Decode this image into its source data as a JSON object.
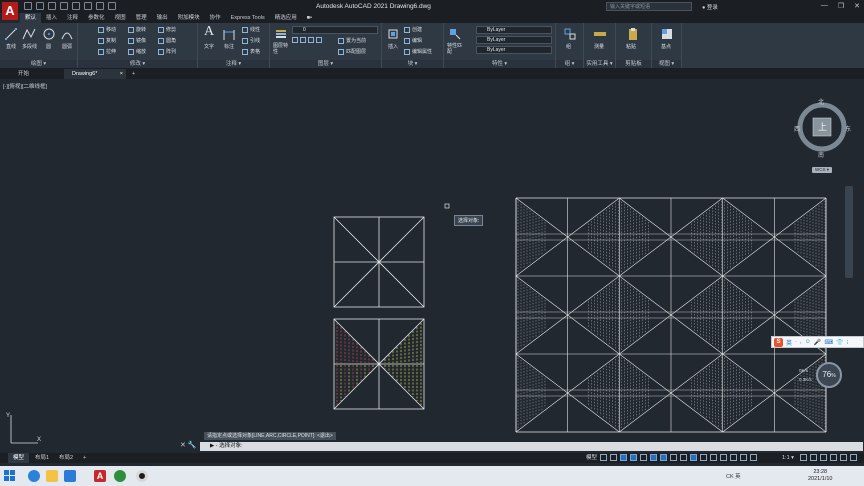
{
  "app": {
    "logo_letter": "A",
    "title": "Autodesk AutoCAD 2021    Drawing6.dwg",
    "search_placeholder": "输入关键字或短语",
    "user_label": "登录",
    "window_controls": [
      "—",
      "❐",
      "✕"
    ]
  },
  "menu": {
    "tabs": [
      "默认",
      "插入",
      "注释",
      "参数化",
      "视图",
      "管理",
      "输出",
      "附加模块",
      "协作",
      "Express Tools",
      "精选应用",
      "■▪"
    ],
    "active_index": 0
  },
  "ribbon": {
    "panels": {
      "draw": {
        "label": "绘图 ▾",
        "line": "直线",
        "polyline": "多段线",
        "circle": "圆",
        "arc": "圆弧"
      },
      "modify": {
        "label": "修改 ▾",
        "move": "移动",
        "rotate": "旋转",
        "trim": "修剪",
        "copy": "复制",
        "mirror": "镜像",
        "fillet": "圆角",
        "stretch": "拉伸",
        "scale": "缩放",
        "array": "阵列"
      },
      "annotation": {
        "label": "注释 ▾",
        "text": "文字",
        "dimension": "标注",
        "linear": "线性",
        "leader": "引线",
        "table": "表格"
      },
      "layers": {
        "label": "图层 ▾",
        "layer_properties": "图层特性",
        "layer_value": "0",
        "make_current": "置为当前",
        "match_layer": "匹配图层"
      },
      "block": {
        "label": "块 ▾",
        "insert": "插入",
        "create": "创建",
        "edit": "编辑",
        "edit_attributes": "编辑属性"
      },
      "properties": {
        "label": "特性 ▾",
        "match": "特性匹配",
        "color": "ByLayer",
        "linetype": "ByLayer",
        "lineweight": "ByLayer"
      },
      "groups": {
        "label": "组 ▾",
        "group": "组"
      },
      "utilities": {
        "label": "实用工具 ▾",
        "measure": "测量"
      },
      "clipboard": {
        "label": "剪贴板",
        "paste": "粘贴"
      },
      "view": {
        "label": "视图 ▾",
        "base": "基点"
      }
    }
  },
  "doc_tabs": {
    "start": "开始",
    "drawing": "Drawing6*",
    "close": "×",
    "add": "+"
  },
  "viewport": {
    "label": "[-][俯视][二维线框]",
    "tooltip": "选择对象:"
  },
  "viewcube": {
    "top": "上",
    "north": "北",
    "south": "南",
    "east": "东",
    "west": "西",
    "wcs": "WCS ▾"
  },
  "ime": {
    "logo": "S",
    "lang": "英",
    "icons": [
      "·",
      ",",
      "☺",
      "🎤",
      "⌨",
      "👕",
      "⁝"
    ]
  },
  "performance": {
    "percent": "76",
    "percent_unit": "%",
    "upload": "0K/s",
    "download": "0.3K/s"
  },
  "command": {
    "history": "请指定点或选择对象[LINE,ARC,CIRCLE,POINT]: <退出>",
    "prompt": "▶ - 选择对象:",
    "side_buttons": "✕  🔧"
  },
  "layout_tabs": {
    "model": "模型",
    "layout1": "布局1",
    "layout2": "布局2",
    "add": "+"
  },
  "status": {
    "model_label": "模型",
    "scale": "1:1 ▾"
  },
  "taskbar": {
    "tray_lang": "CK 英",
    "time": "23:28",
    "date": "2021/1/10"
  },
  "colors": {
    "background": "#212830",
    "ribbon": "#2f3944",
    "drawing_lines": "#e6e6e6",
    "hatch_red": "#d24c4c",
    "hatch_yellow": "#d9d34a",
    "accent": "#2d6eb3"
  }
}
